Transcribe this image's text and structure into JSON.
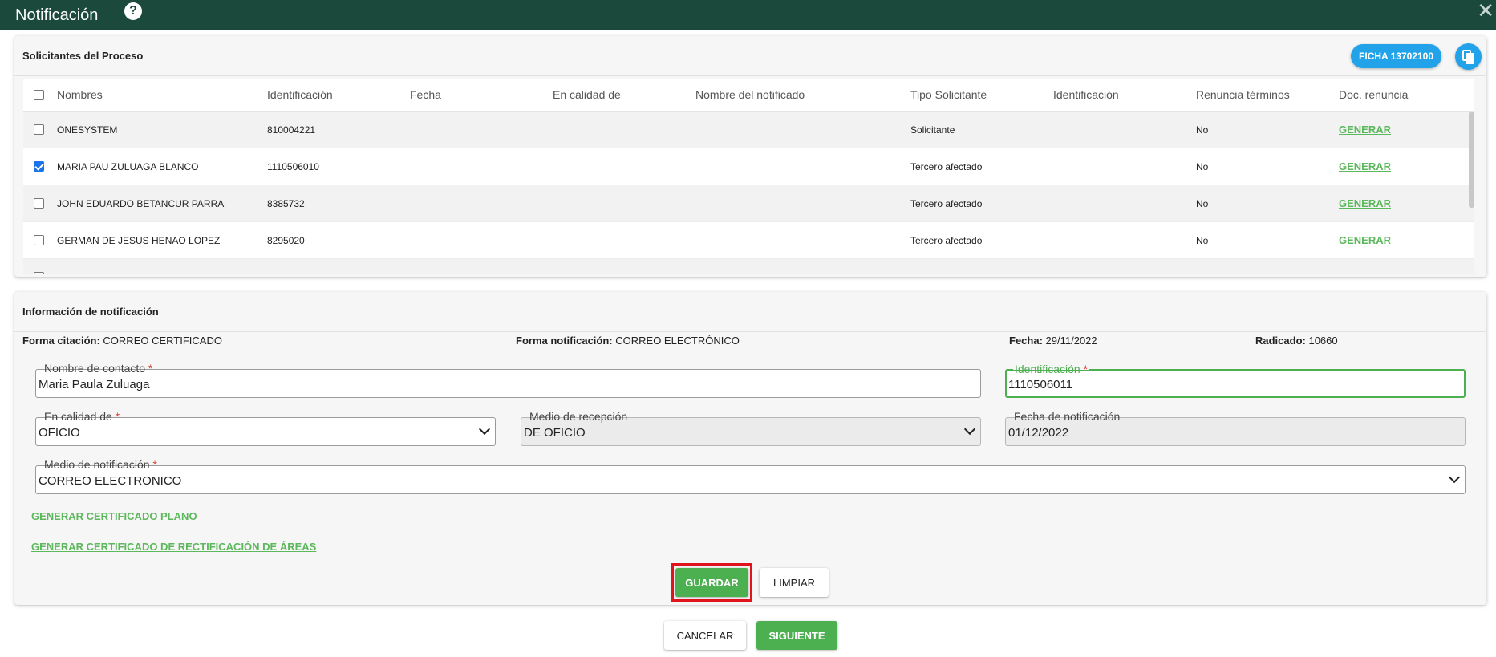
{
  "window": {
    "title": "Notificación",
    "help_icon": "help-circle-icon",
    "close_icon": "close-icon"
  },
  "solicitantes": {
    "title": "Solicitantes del Proceso",
    "ficha_label": "FICHA 13702100",
    "copy_icon": "copy-icon",
    "columns": [
      "Nombres",
      "Identificación",
      "Fecha",
      "En calidad de",
      "Nombre del notificado",
      "Tipo Solicitante",
      "Identificación",
      "Renuncia términos",
      "Doc. renuncia"
    ],
    "rows": [
      {
        "checked": false,
        "nombre": "ONESYSTEM",
        "identificacion": "810004221",
        "fecha": "",
        "calidad": "",
        "notificado": "",
        "tipo": "Solicitante",
        "identificacion2": "",
        "renuncia": "No",
        "doc": "GENERAR"
      },
      {
        "checked": true,
        "nombre": "MARIA PAU ZULUAGA BLANCO",
        "identificacion": "1110506010",
        "fecha": "",
        "calidad": "",
        "notificado": "",
        "tipo": "Tercero afectado",
        "identificacion2": "",
        "renuncia": "No",
        "doc": "GENERAR"
      },
      {
        "checked": false,
        "nombre": "JOHN EDUARDO BETANCUR PARRA",
        "identificacion": "8385732",
        "fecha": "",
        "calidad": "",
        "notificado": "",
        "tipo": "Tercero afectado",
        "identificacion2": "",
        "renuncia": "No",
        "doc": "GENERAR"
      },
      {
        "checked": false,
        "nombre": "GERMAN DE JESUS HENAO LOPEZ",
        "identificacion": "8295020",
        "fecha": "",
        "calidad": "",
        "notificado": "",
        "tipo": "Tercero afectado",
        "identificacion2": "",
        "renuncia": "No",
        "doc": "GENERAR"
      }
    ]
  },
  "informacion": {
    "title": "Información de notificación",
    "forma_citacion_label": "Forma citación:",
    "forma_citacion": "CORREO CERTIFICADO",
    "forma_notificacion_label": "Forma notificación:",
    "forma_notificacion": "CORREO ELECTRÓNICO",
    "fecha_label": "Fecha:",
    "fecha": "29/11/2022",
    "radicado_label": "Radicado:",
    "radicado": "10660",
    "fields": {
      "nombre_contacto": {
        "label": "Nombre de contacto",
        "value": "Maria Paula Zuluaga",
        "required": "*"
      },
      "identificacion": {
        "label": "Identificación",
        "value": "1110506011",
        "required": "*"
      },
      "en_calidad": {
        "label": "En calidad de",
        "value": "OFICIO",
        "required": "*"
      },
      "medio_recepcion": {
        "label": "Medio de recepción",
        "value": "DE OFICIO"
      },
      "fecha_notificacion": {
        "label": "Fecha de notificación",
        "value": "01/12/2022"
      },
      "medio_notificacion": {
        "label": "Medio de notificación",
        "value": "CORREO ELECTRONICO",
        "required": "*"
      }
    },
    "link_plano": "GENERAR CERTIFICADO PLANO",
    "link_rectificacion": "GENERAR CERTIFICADO DE RECTIFICACIÓN DE ÁREAS",
    "guardar": "GUARDAR",
    "limpiar": "LIMPIAR"
  },
  "footer": {
    "cancelar": "CANCELAR",
    "siguiente": "SIGUIENTE"
  },
  "colors": {
    "header_bg": "#1b4a3c",
    "accent_green": "#4caf50",
    "badge_blue": "#22a3e9",
    "highlight_red": "#e0141c"
  }
}
